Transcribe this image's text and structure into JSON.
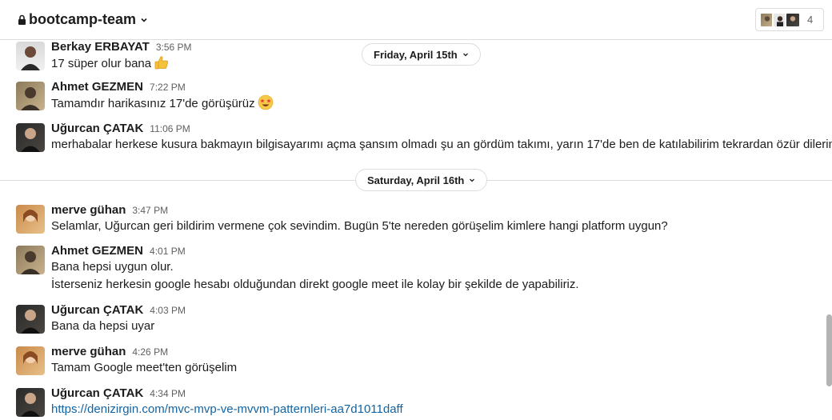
{
  "channel": {
    "name": "bootcamp-team",
    "member_count": "4"
  },
  "dates": [
    {
      "label": "Friday, April 15th"
    },
    {
      "label": "Saturday, April 16th"
    }
  ],
  "messages": [
    {
      "author": "Berkay ERBAYAT",
      "time": "3:56 PM",
      "text": "17 süper olur bana",
      "emoji": "thumbs-up-emoji"
    },
    {
      "author": "Ahmet GEZMEN",
      "time": "7:22 PM",
      "text": "Tamamdır harikasınız 17'de görüşürüz",
      "emoji": "star-struck-emoji"
    },
    {
      "author": "Uğurcan ÇATAK",
      "time": "11:06 PM",
      "text": "merhabalar herkese kusura bakmayın bilgisayarımı açma şansım olmadı şu an gördüm takımı, yarın 17'de ben de katılabilirim tekrardan özür dilerim"
    },
    {
      "author": "merve gühan",
      "time": "3:47 PM",
      "text": "Selamlar, Uğurcan geri bildirim vermene çok sevindim. Bugün 5'te nereden görüşelim kimlere hangi platform uygun?"
    },
    {
      "author": "Ahmet GEZMEN",
      "time": "4:01 PM",
      "text": "Bana hepsi uygun olur.",
      "text2": "İsterseniz herkesin google hesabı olduğundan direkt google meet ile kolay bir şekilde de yapabiliriz."
    },
    {
      "author": "Uğurcan ÇATAK",
      "time": "4:03 PM",
      "text": "Bana da hepsi uyar"
    },
    {
      "author": "merve gühan",
      "time": "4:26 PM",
      "text": "Tamam Google meet'ten görüşelim"
    },
    {
      "author": "Uğurcan ÇATAK",
      "time": "4:34 PM",
      "link": "https://denizirgin.com/mvc-mvp-ve-mvvm-patternleri-aa7d1011daff"
    }
  ],
  "colors": {
    "link": "#1264a3",
    "divider": "#dddddd",
    "muted": "#616061"
  }
}
